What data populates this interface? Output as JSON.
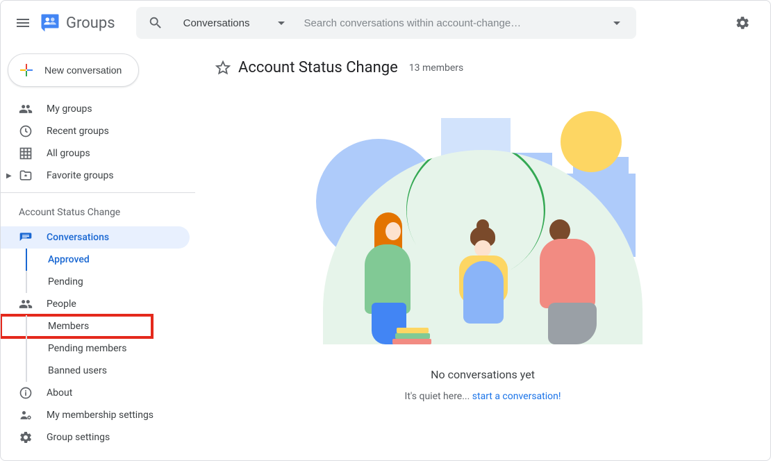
{
  "header": {
    "app_name": "Groups",
    "search_scope": "Conversations",
    "search_placeholder": "Search conversations within account-change…"
  },
  "sidebar": {
    "new_conversation_label": "New conversation",
    "nav": {
      "my_groups": "My groups",
      "recent_groups": "Recent groups",
      "all_groups": "All groups",
      "favorite_groups": "Favorite groups"
    },
    "group_section_title": "Account Status Change",
    "group_nav": {
      "conversations": "Conversations",
      "approved": "Approved",
      "pending": "Pending",
      "people": "People",
      "members": "Members",
      "pending_members": "Pending members",
      "banned_users": "Banned users",
      "about": "About",
      "my_membership_settings": "My membership settings",
      "group_settings": "Group settings"
    }
  },
  "main": {
    "title": "Account Status Change",
    "member_count": "13 members",
    "empty_title": "No conversations yet",
    "empty_prefix": "It's quiet here... ",
    "empty_link": "start a conversation!"
  }
}
